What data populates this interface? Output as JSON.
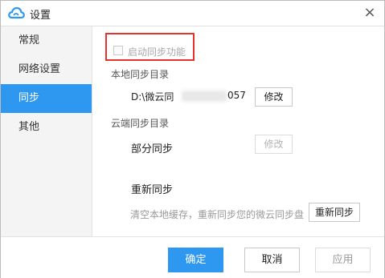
{
  "window": {
    "title": "设置",
    "close_glyph": "×",
    "app_icon": "cloud-icon",
    "accent": "#2e97f0"
  },
  "sidebar": {
    "items": [
      {
        "label": "常规",
        "active": false
      },
      {
        "label": "网络设置",
        "active": false
      },
      {
        "label": "同步",
        "active": true
      },
      {
        "label": "其他",
        "active": false
      }
    ]
  },
  "sync": {
    "enable_label": "启动同步功能",
    "enable_checked": false,
    "highlight_color": "#e5322d",
    "local_dir_title": "本地同步目录",
    "local_dir_value": "D:\\微云同",
    "local_dir_value_tail": "057",
    "modify_label": "修改",
    "cloud_dir_title": "云端同步目录",
    "partial_sync_label": "部分同步",
    "partial_modify_label": "修改",
    "resync_title": "重新同步",
    "resync_hint": "清空本地缓存，重新同步您的微云同步盘",
    "resync_button": "重新同步"
  },
  "footer": {
    "ok_label": "确定",
    "cancel_label": "取消",
    "apply_label": "应用"
  }
}
